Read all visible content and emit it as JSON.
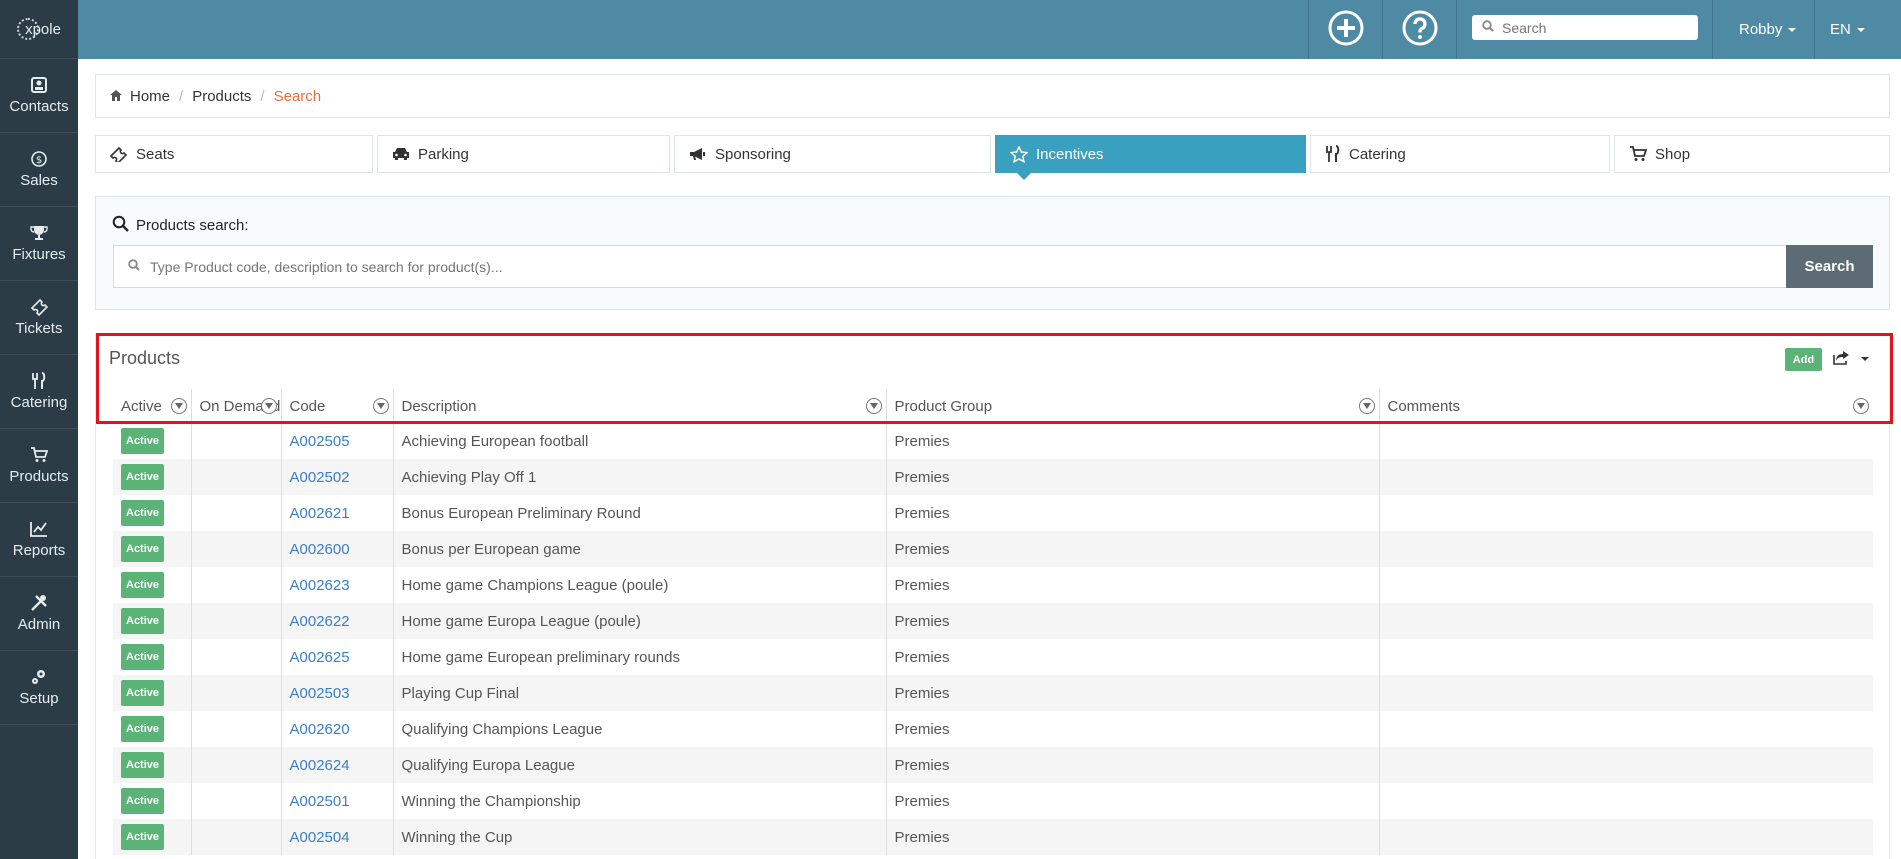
{
  "app": {
    "logo_text": "xpole"
  },
  "sidebar": {
    "items": [
      {
        "label": "Contacts",
        "icon": "contacts-icon"
      },
      {
        "label": "Sales",
        "icon": "dollar-icon"
      },
      {
        "label": "Fixtures",
        "icon": "trophy-icon"
      },
      {
        "label": "Tickets",
        "icon": "ticket-icon"
      },
      {
        "label": "Catering",
        "icon": "cutlery-icon"
      },
      {
        "label": "Products",
        "icon": "cart-icon"
      },
      {
        "label": "Reports",
        "icon": "chart-icon"
      },
      {
        "label": "Admin",
        "icon": "tools-icon"
      },
      {
        "label": "Setup",
        "icon": "gears-icon"
      }
    ]
  },
  "topbar": {
    "search_placeholder": "Search",
    "user": "Robby",
    "language": "EN"
  },
  "breadcrumb": {
    "home": "Home",
    "products": "Products",
    "current": "Search"
  },
  "tabs": [
    {
      "label": "Seats"
    },
    {
      "label": "Parking"
    },
    {
      "label": "Sponsoring"
    },
    {
      "label": "Incentives"
    },
    {
      "label": "Catering"
    },
    {
      "label": "Shop"
    }
  ],
  "search": {
    "title": "Products search:",
    "placeholder": "Type Product code, description to search for product(s)...",
    "button": "Search"
  },
  "products": {
    "title": "Products",
    "add_label": "Add",
    "columns": [
      "Active",
      "On Demand",
      "Code",
      "Description",
      "Product Group",
      "Comments"
    ],
    "rows": [
      {
        "status": "Active",
        "on_demand": "",
        "code": "A002505",
        "description": "Achieving European football",
        "group": "Premies",
        "comments": ""
      },
      {
        "status": "Active",
        "on_demand": "",
        "code": "A002502",
        "description": "Achieving Play Off 1",
        "group": "Premies",
        "comments": ""
      },
      {
        "status": "Active",
        "on_demand": "",
        "code": "A002621",
        "description": "Bonus European Preliminary Round",
        "group": "Premies",
        "comments": ""
      },
      {
        "status": "Active",
        "on_demand": "",
        "code": "A002600",
        "description": "Bonus per European game",
        "group": "Premies",
        "comments": ""
      },
      {
        "status": "Active",
        "on_demand": "",
        "code": "A002623",
        "description": "Home game Champions League (poule)",
        "group": "Premies",
        "comments": ""
      },
      {
        "status": "Active",
        "on_demand": "",
        "code": "A002622",
        "description": "Home game Europa League (poule)",
        "group": "Premies",
        "comments": ""
      },
      {
        "status": "Active",
        "on_demand": "",
        "code": "A002625",
        "description": "Home game European preliminary rounds",
        "group": "Premies",
        "comments": ""
      },
      {
        "status": "Active",
        "on_demand": "",
        "code": "A002503",
        "description": "Playing Cup Final",
        "group": "Premies",
        "comments": ""
      },
      {
        "status": "Active",
        "on_demand": "",
        "code": "A002620",
        "description": "Qualifying Champions League",
        "group": "Premies",
        "comments": ""
      },
      {
        "status": "Active",
        "on_demand": "",
        "code": "A002624",
        "description": "Qualifying Europa League",
        "group": "Premies",
        "comments": ""
      },
      {
        "status": "Active",
        "on_demand": "",
        "code": "A002501",
        "description": "Winning the Championship",
        "group": "Premies",
        "comments": ""
      },
      {
        "status": "Active",
        "on_demand": "",
        "code": "A002504",
        "description": "Winning the Cup",
        "group": "Premies",
        "comments": ""
      }
    ]
  }
}
